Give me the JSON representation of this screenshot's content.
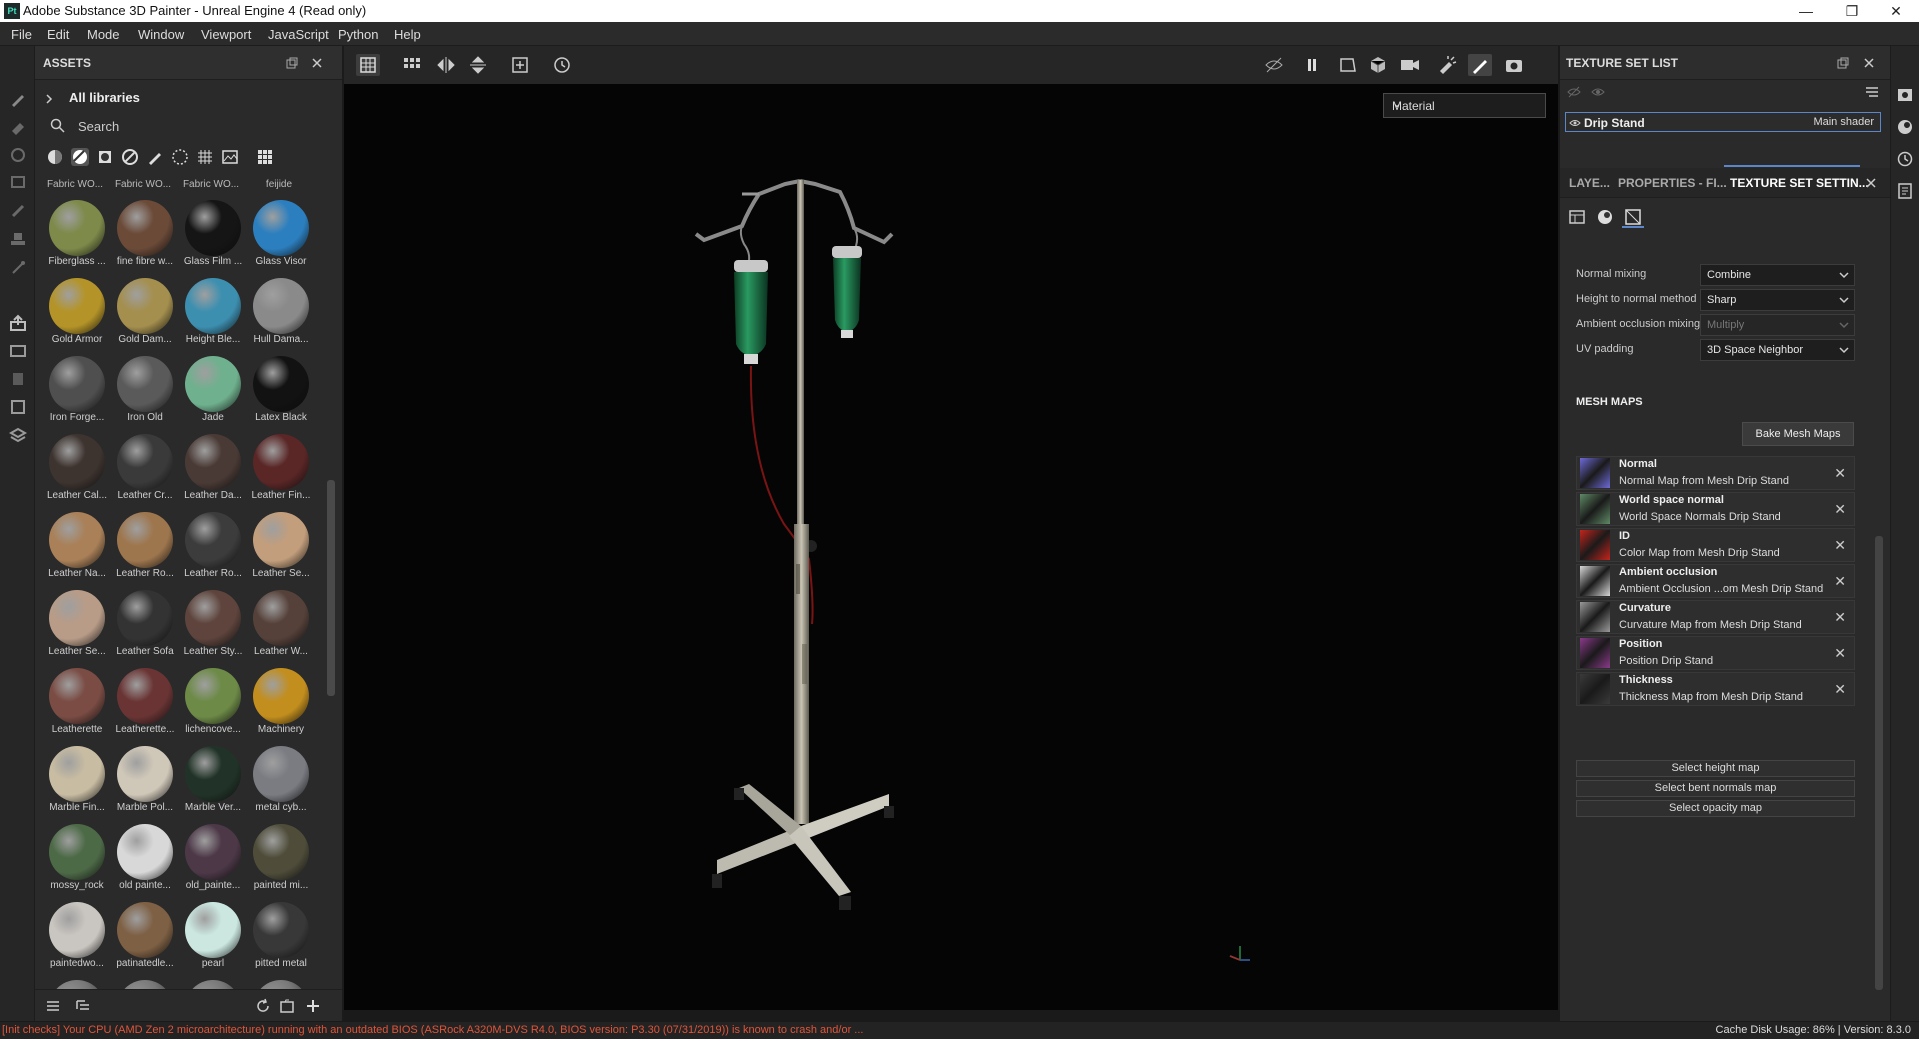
{
  "window": {
    "app_icon": "Pt",
    "title": "Adobe Substance 3D Painter - Unreal Engine 4 (Read only)",
    "controls": [
      "minimize-icon",
      "restore-icon",
      "close-icon"
    ],
    "minimize_glyph": "—",
    "restore_glyph": "❐",
    "close_glyph": "✕"
  },
  "menu": [
    "File",
    "Edit",
    "Mode",
    "Window",
    "Viewport",
    "JavaScript",
    "Python",
    "Help"
  ],
  "assets": {
    "title": "ASSETS",
    "library": "All libraries",
    "search_placeholder": "Search",
    "top_labels": [
      "Fabric WO...",
      "Fabric WO...",
      "Fabric WO...",
      "feijide"
    ],
    "materials": [
      {
        "label": "Fiberglass ...",
        "color": "#7d8a4a"
      },
      {
        "label": "fine fibre w...",
        "color": "#6b4a38"
      },
      {
        "label": "Glass Film ...",
        "color": "#151515"
      },
      {
        "label": "Glass Visor",
        "color": "#2c7fbf"
      },
      {
        "label": "Gold Armor",
        "color": "#b49428"
      },
      {
        "label": "Gold Dam...",
        "color": "#a48f4e"
      },
      {
        "label": "Height Ble...",
        "color": "#3d8fb0"
      },
      {
        "label": "Hull Dama...",
        "color": "#8a8a8a"
      },
      {
        "label": "Iron Forge...",
        "color": "#4f4f4f"
      },
      {
        "label": "Iron Old",
        "color": "#5a5a5a"
      },
      {
        "label": "Jade",
        "color": "#6fb08e"
      },
      {
        "label": "Latex Black",
        "color": "#121212"
      },
      {
        "label": "Leather Cal...",
        "color": "#3d332f"
      },
      {
        "label": "Leather Cr...",
        "color": "#3a3a3a"
      },
      {
        "label": "Leather Da...",
        "color": "#4a3a35"
      },
      {
        "label": "Leather Fin...",
        "color": "#5a2626"
      },
      {
        "label": "Leather Na...",
        "color": "#a98058"
      },
      {
        "label": "Leather Ro...",
        "color": "#9e764e"
      },
      {
        "label": "Leather Ro...",
        "color": "#3c3c3c"
      },
      {
        "label": "Leather Se...",
        "color": "#c29e7c"
      },
      {
        "label": "Leather Se...",
        "color": "#b89c88"
      },
      {
        "label": "Leather Sofa",
        "color": "#333333"
      },
      {
        "label": "Leather Sty...",
        "color": "#5e443c"
      },
      {
        "label": "Leather W...",
        "color": "#56413a"
      },
      {
        "label": "Leatherette",
        "color": "#7a4c44"
      },
      {
        "label": "Leatherette...",
        "color": "#6a3434"
      },
      {
        "label": "lichencove...",
        "color": "#6d8a47"
      },
      {
        "label": "Machinery",
        "color": "#c28e1e"
      },
      {
        "label": "Marble Fin...",
        "color": "#c8bca2"
      },
      {
        "label": "Marble Pol...",
        "color": "#cfc7b8"
      },
      {
        "label": "Marble Ver...",
        "color": "#213328"
      },
      {
        "label": "metal cyb...",
        "color": "#7a7c82"
      },
      {
        "label": "mossy_rock",
        "color": "#4d6a47"
      },
      {
        "label": "old painte...",
        "color": "#d8d8d8"
      },
      {
        "label": "old_painte...",
        "color": "#4d3848"
      },
      {
        "label": "painted mi...",
        "color": "#4f4d3a"
      },
      {
        "label": "paintedwo...",
        "color": "#c9c5c0"
      },
      {
        "label": "patinatedle...",
        "color": "#7e6044"
      },
      {
        "label": "pearl",
        "color": "#cbe7e0"
      },
      {
        "label": "pitted metal",
        "color": "#383838"
      }
    ]
  },
  "viewport": {
    "mode_select": "Material",
    "mode_arrow": "⌄"
  },
  "texture_set_list": {
    "title": "TEXTURE SET LIST",
    "item_name": "Drip Stand",
    "item_shader": "Main shader"
  },
  "tabs": [
    {
      "label": "LAYE...",
      "active": false
    },
    {
      "label": "PROPERTIES - FI...",
      "active": false
    },
    {
      "label": "TEXTURE SET SETTIN...",
      "active": true
    }
  ],
  "settings": {
    "rows": [
      {
        "label": "Normal mixing",
        "value": "Combine",
        "disabled": false
      },
      {
        "label": "Height to normal method",
        "value": "Sharp",
        "disabled": false
      },
      {
        "label": "Ambient occlusion mixing",
        "value": "Multiply",
        "disabled": true
      },
      {
        "label": "UV padding",
        "value": "3D Space Neighbor",
        "disabled": false
      }
    ],
    "mesh_maps_title": "MESH MAPS",
    "bake_button": "Bake Mesh Maps",
    "mesh_maps": [
      {
        "name": "Normal",
        "desc": "Normal Map from Mesh Drip Stand",
        "color": "#6e6ad8"
      },
      {
        "name": "World space normal",
        "desc": "World Space Normals Drip Stand",
        "color": "#5f8a66"
      },
      {
        "name": "ID",
        "desc": "Color Map from Mesh Drip Stand",
        "color": "#c4241c"
      },
      {
        "name": "Ambient occlusion",
        "desc": "Ambient Occlusion ...om Mesh Drip Stand",
        "color": "#d8d8d8"
      },
      {
        "name": "Curvature",
        "desc": "Curvature Map from Mesh Drip Stand",
        "color": "#9a9a9a"
      },
      {
        "name": "Position",
        "desc": "Position Drip Stand",
        "color": "#8a3a8a"
      },
      {
        "name": "Thickness",
        "desc": "Thickness Map from Mesh Drip Stand",
        "color": "#3a3a3a"
      }
    ],
    "remove_glyph": "✕",
    "select_buttons": [
      "Select height map",
      "Select bent normals map",
      "Select opacity map"
    ]
  },
  "status": {
    "error": "[Init checks] Your CPU (AMD Zen 2 microarchitecture) running with an outdated BIOS (ASRock A320M-DVS R4.0, BIOS version: P3.30 (07/31/2019)) is known to crash and/or ...",
    "cache": "Cache Disk Usage:   86% | Version: 8.3.0"
  },
  "colors": {
    "accent": "#5b87c9",
    "error": "#e0553a",
    "iv_fluid": "#1f7a4a",
    "tube": "#8a1a1a"
  }
}
